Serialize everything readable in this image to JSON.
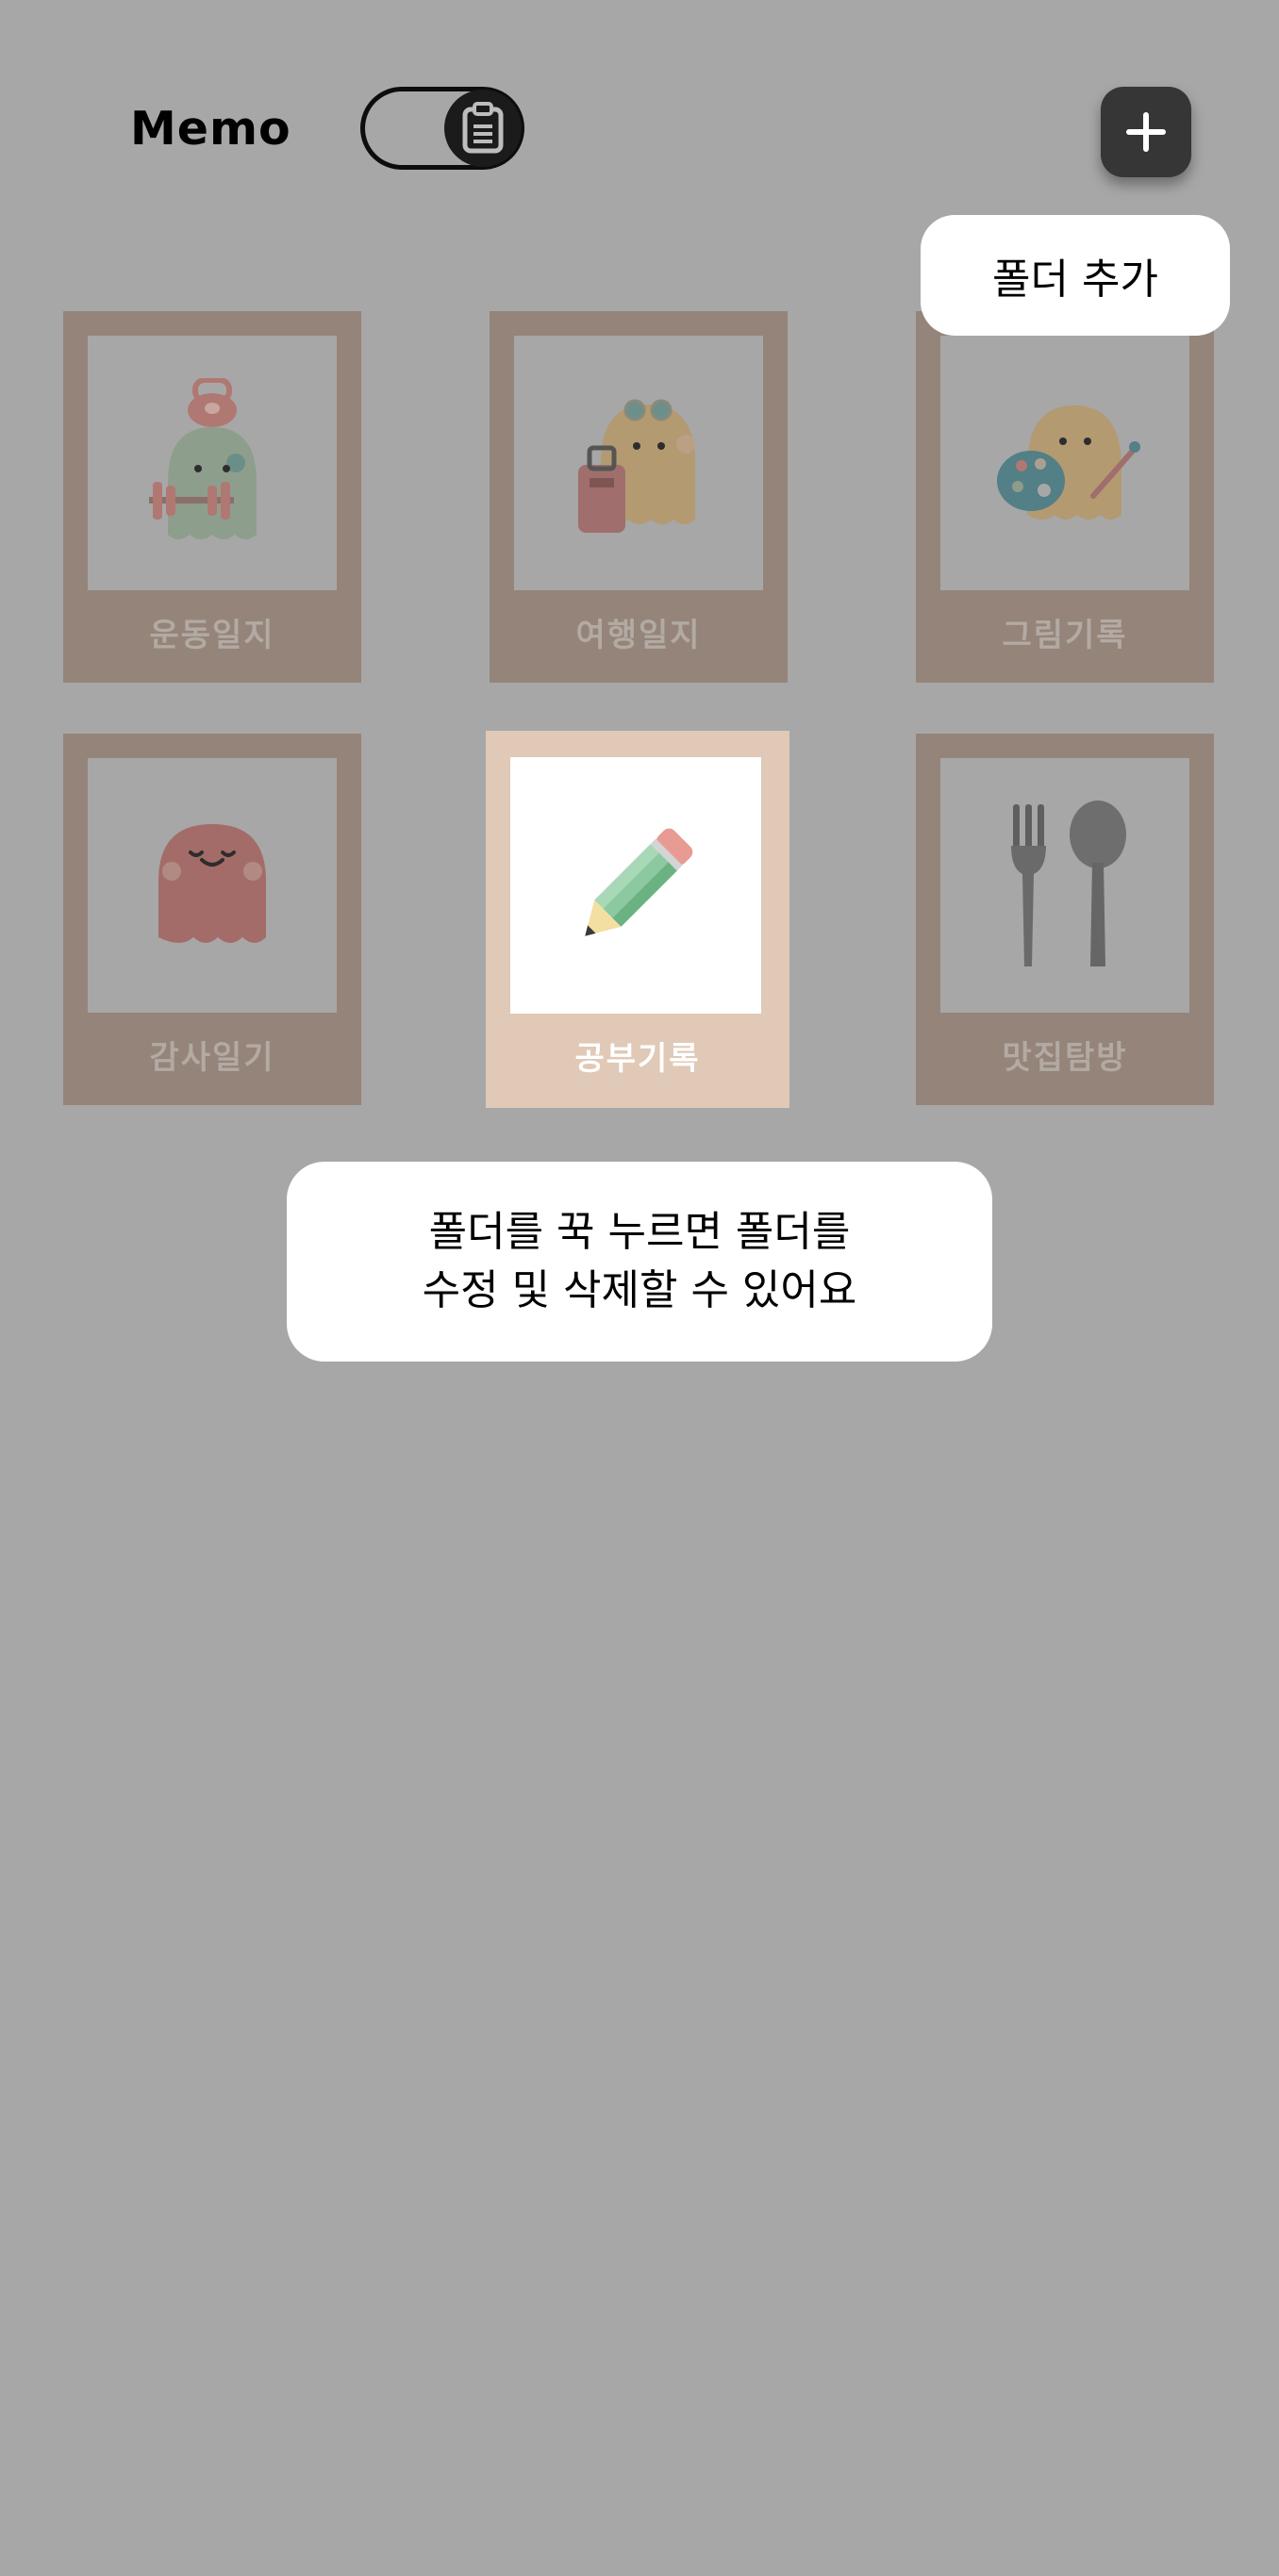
{
  "header": {
    "title": "Memo",
    "toggle_icon": "clipboard-icon",
    "add_icon": "plus-icon"
  },
  "tooltips": {
    "add_folder": "폴더 추가",
    "help_line1": "폴더를 꾹 누르면 폴더를",
    "help_line2": "수정 및 삭제할 수 있어요"
  },
  "folders": [
    {
      "label": "운동일지",
      "icon": "ghost-dumbbell-icon",
      "active": false
    },
    {
      "label": "여행일지",
      "icon": "ghost-suitcase-icon",
      "active": false
    },
    {
      "label": "그림기록",
      "icon": "ghost-palette-icon",
      "active": false
    },
    {
      "label": "감사일기",
      "icon": "ghost-smile-icon",
      "active": false
    },
    {
      "label": "공부기록",
      "icon": "pencil-icon",
      "active": true
    },
    {
      "label": "맛집탐방",
      "icon": "fork-spoon-icon",
      "active": false
    }
  ],
  "colors": {
    "overlay": "#a7a7a7",
    "folder_dimmed": "#958479",
    "folder_active": "#e0c9b7",
    "button": "#363636"
  }
}
